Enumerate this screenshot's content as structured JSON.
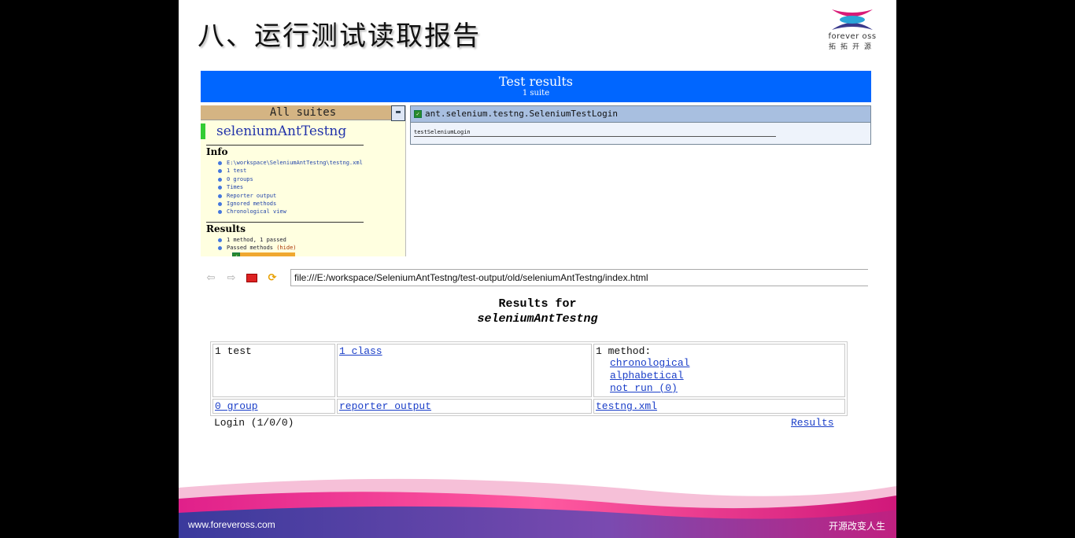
{
  "slide": {
    "title": "八、运行测试读取报告",
    "logo_line1": "forever oss",
    "logo_line2": "拓拓开源",
    "footer_url": "www.foreveross.com",
    "footer_slogan": "开源改变人生"
  },
  "testng": {
    "header_title": "Test results",
    "header_sub": "1 suite",
    "all_suites": "All suites",
    "suite_name": "seleniumAntTestng",
    "info_heading": "Info",
    "info_items": [
      "E:\\workspace\\SeleniumAntTestng\\testng.xml",
      "1 test",
      "0 groups",
      "Times",
      "Reporter output",
      "Ignored methods",
      "Chronological view"
    ],
    "results_heading": "Results",
    "results_item1": "1 method, 1 passed",
    "results_item2_prefix": "Passed methods ",
    "results_hide": "(hide)",
    "passed_method": "testSeleniumLogin",
    "class_name": "ant.selenium.testng.SeleniumTestLogin",
    "method_name": "testSeleniumLogin"
  },
  "browser": {
    "url": "file:///E:/workspace/SeleniumAntTestng/test-output/old/seleniumAntTestng/index.html"
  },
  "report": {
    "title_line1": "Results for",
    "title_line2": "seleniumAntTestng",
    "cell_tests": "1 test",
    "cell_classes": "1 class",
    "cell_methods": "1 method:",
    "link_chronological": "chronological",
    "link_alphabetical": "alphabetical",
    "link_not_run": "not run (0)",
    "link_groups": "0 group",
    "link_reporter": "reporter output",
    "link_testng_xml": "testng.xml",
    "login_summary": "Login (1/0/0)",
    "results_link": "Results"
  },
  "colors": {
    "header_blue": "#0066ff",
    "panel_yellow": "#ffffe0",
    "suite_tan": "#d4b483",
    "pass_green": "#33cc33"
  }
}
